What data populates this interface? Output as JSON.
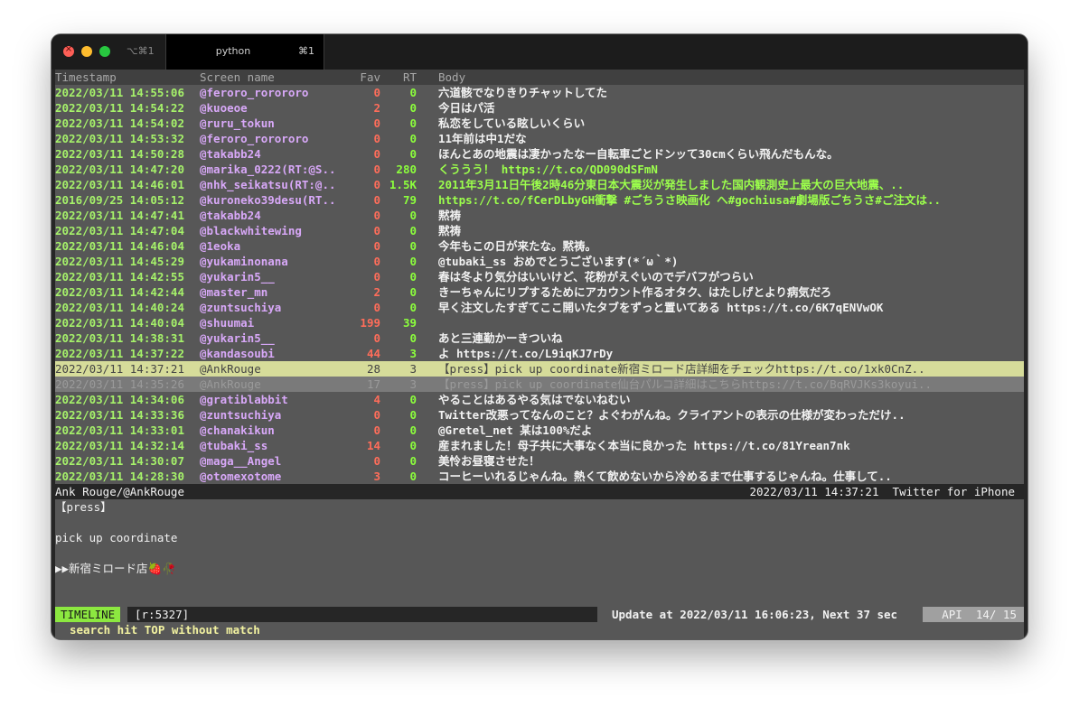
{
  "titlebar": {
    "first_tab_shortcut": "⌥⌘1",
    "active_tab_title": "python",
    "active_tab_shortcut": "⌘1"
  },
  "columns": {
    "timestamp": "Timestamp",
    "screen_name": "Screen name",
    "fav": "Fav",
    "rt": "RT",
    "body": "Body"
  },
  "rows": [
    {
      "ts": "2022/03/11 14:55:06",
      "sn": "@feroro_rorororo",
      "fav": "0",
      "rt": "0",
      "body": "六道骸でなりきりチャットしてた"
    },
    {
      "ts": "2022/03/11 14:54:22",
      "sn": "@kuoeoe",
      "fav": "2",
      "rt": "0",
      "body": "今日はパ活"
    },
    {
      "ts": "2022/03/11 14:54:02",
      "sn": "@ruru_tokun",
      "fav": "0",
      "rt": "0",
      "body": "私恋をしている眩しいくらい"
    },
    {
      "ts": "2022/03/11 14:53:32",
      "sn": "@feroro_rorororo",
      "fav": "0",
      "rt": "0",
      "body": "11年前は中1だな"
    },
    {
      "ts": "2022/03/11 14:50:28",
      "sn": "@takabb24",
      "fav": "0",
      "rt": "0",
      "body": "ほんとあの地震は凄かったなー自転車ごとドンッて30cmくらい飛んだもんな。"
    },
    {
      "ts": "2022/03/11 14:47:20",
      "sn": "@marika_0222(RT:@S..",
      "fav": "0",
      "rt": "280",
      "body": "くううう！ https://t.co/QD090dSFmN"
    },
    {
      "ts": "2022/03/11 14:46:01",
      "sn": "@nhk_seikatsu(RT:@..",
      "fav": "0",
      "rt": "1.5K",
      "body": "2011年3月11日午後2時46分東日本大震災が発生しました国内観測史上最大の巨大地震、.."
    },
    {
      "ts": "2016/09/25 14:05:12",
      "sn": "@kuroneko39desu(RT..",
      "fav": "0",
      "rt": "79",
      "body": "https://t.co/fCerDLbyGH衝撃 #ごちうさ映画化 へ#gochiusa#劇場版ごちうさ#ご注文は.."
    },
    {
      "ts": "2022/03/11 14:47:41",
      "sn": "@takabb24",
      "fav": "0",
      "rt": "0",
      "body": "黙祷"
    },
    {
      "ts": "2022/03/11 14:47:04",
      "sn": "@blackwhitewing",
      "fav": "0",
      "rt": "0",
      "body": "黙祷"
    },
    {
      "ts": "2022/03/11 14:46:04",
      "sn": "@1eoka",
      "fav": "0",
      "rt": "0",
      "body": "今年もこの日が来たな。黙祷。"
    },
    {
      "ts": "2022/03/11 14:45:29",
      "sn": "@yukaminonana",
      "fav": "0",
      "rt": "0",
      "body": "@tubaki_ss おめでとうございます(*´ω｀*)"
    },
    {
      "ts": "2022/03/11 14:42:55",
      "sn": "@yukarin5__",
      "fav": "0",
      "rt": "0",
      "body": "春は冬より気分はいいけど、花粉がえぐいのでデバフがつらい"
    },
    {
      "ts": "2022/03/11 14:42:44",
      "sn": "@master_mn",
      "fav": "2",
      "rt": "0",
      "body": "きーちゃんにリプするためにアカウント作るオタク、はたしげとより病気だろ"
    },
    {
      "ts": "2022/03/11 14:40:24",
      "sn": "@zuntsuchiya",
      "fav": "0",
      "rt": "0",
      "body": "早く注文したすぎてここ開いたタブをずっと置いてある https://t.co/6K7qENVwOK"
    },
    {
      "ts": "2022/03/11 14:40:04",
      "sn": "@shuumai",
      "fav": "199",
      "rt": "39",
      "body": ""
    },
    {
      "ts": "2022/03/11 14:38:31",
      "sn": "@yukarin5__",
      "fav": "0",
      "rt": "0",
      "body": "あと三連勤かーきついね"
    },
    {
      "ts": "2022/03/11 14:37:22",
      "sn": "@kandasoubi",
      "fav": "44",
      "rt": "3",
      "body": "よ https://t.co/L9iqKJ7rDy"
    },
    {
      "ts": "2022/03/11 14:37:21",
      "sn": "@AnkRouge",
      "fav": "28",
      "rt": "3",
      "body": "【press】pick up coordinate新宿ミロード店詳細をチェックhttps://t.co/1xk0CnZ.."
    },
    {
      "ts": "2022/03/11 14:35:26",
      "sn": "@AnkRouge",
      "fav": "17",
      "rt": "3",
      "body": "【press】pick up coordinate仙台パルコ詳細はこちらhttps://t.co/BqRVJKs3koyui.."
    },
    {
      "ts": "2022/03/11 14:34:06",
      "sn": "@gratiblabbit",
      "fav": "4",
      "rt": "0",
      "body": "やることはあるやる気はでないねむい"
    },
    {
      "ts": "2022/03/11 14:33:36",
      "sn": "@zuntsuchiya",
      "fav": "0",
      "rt": "0",
      "body": "Twitter改悪ってなんのこと？よぐわがんね。クライアントの表示の仕様が変わっただけ.."
    },
    {
      "ts": "2022/03/11 14:33:01",
      "sn": "@chanakikun",
      "fav": "0",
      "rt": "0",
      "body": "@Gretel_net 某は100%だよ"
    },
    {
      "ts": "2022/03/11 14:32:14",
      "sn": "@tubaki_ss",
      "fav": "14",
      "rt": "0",
      "body": "産まれました！母子共に大事なく本当に良かった https://t.co/81Yrean7nk"
    },
    {
      "ts": "2022/03/11 14:30:07",
      "sn": "@maga__Angel",
      "fav": "0",
      "rt": "0",
      "body": "美怜お昼寝させた！"
    },
    {
      "ts": "2022/03/11 14:28:30",
      "sn": "@otomexotome",
      "fav": "3",
      "rt": "0",
      "body": "コーヒーいれるじゃんね。熱くて飲めないから冷めるまで仕事するじゃんね。仕事して.."
    }
  ],
  "detail": {
    "header_left": "Ank Rouge/@AnkRouge",
    "header_right": "2022/03/11 14:37:21  Twitter for iPhone",
    "line1": "【press】",
    "line2": "",
    "line3": "pick up coordinate",
    "line4": "",
    "line5": "▶▶新宿ミロード店🍓🥀"
  },
  "statusbar": {
    "mode": "TIMELINE",
    "rate": "[r:5327]",
    "update": "Update at 2022/03/11 16:06:23, Next 37 sec",
    "api": "API  14/ 15"
  },
  "message": "search hit TOP without match",
  "colors": {
    "timestamp": "#a6f26a",
    "screen_name": "#d8a8f8",
    "fav": "#ff6d5a",
    "rt": "#8cff3c",
    "selected_row": "#d6dc9a"
  }
}
